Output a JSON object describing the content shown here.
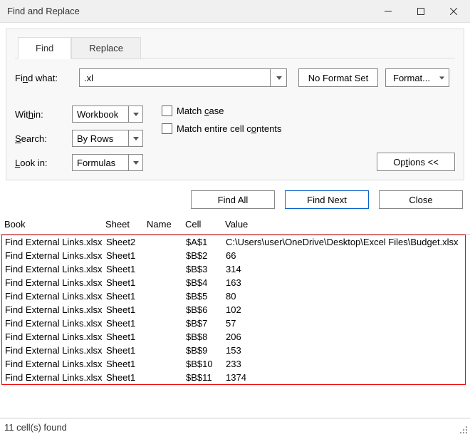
{
  "window": {
    "title": "Find and Replace"
  },
  "tabs": {
    "find": "Find",
    "replace": "Replace"
  },
  "findwhat_label": "Find what:",
  "findwhat_value": ".xl",
  "noformat": "No Format Set",
  "format": "Format...",
  "opts": {
    "within_label": "Within:",
    "within_value": "Workbook",
    "search_label": "Search:",
    "search_value": "By Rows",
    "lookin_label": "Look in:",
    "lookin_value": "Formulas",
    "matchcase": "Match case",
    "matchentire": "Match entire cell contents",
    "options_btn": "Options <<"
  },
  "actions": {
    "findall": "Find All",
    "findnext": "Find Next",
    "close": "Close"
  },
  "columns": {
    "book": "Book",
    "sheet": "Sheet",
    "name": "Name",
    "cell": "Cell",
    "value": "Value"
  },
  "rows": [
    {
      "book": "Find External Links.xlsx",
      "sheet": "Sheet2",
      "name": "",
      "cell": "$A$1",
      "value": "C:\\Users\\user\\OneDrive\\Desktop\\Excel Files\\Budget.xlsx"
    },
    {
      "book": "Find External Links.xlsx",
      "sheet": "Sheet1",
      "name": "",
      "cell": "$B$2",
      "value": "66"
    },
    {
      "book": "Find External Links.xlsx",
      "sheet": "Sheet1",
      "name": "",
      "cell": "$B$3",
      "value": "314"
    },
    {
      "book": "Find External Links.xlsx",
      "sheet": "Sheet1",
      "name": "",
      "cell": "$B$4",
      "value": "163"
    },
    {
      "book": "Find External Links.xlsx",
      "sheet": "Sheet1",
      "name": "",
      "cell": "$B$5",
      "value": "80"
    },
    {
      "book": "Find External Links.xlsx",
      "sheet": "Sheet1",
      "name": "",
      "cell": "$B$6",
      "value": "102"
    },
    {
      "book": "Find External Links.xlsx",
      "sheet": "Sheet1",
      "name": "",
      "cell": "$B$7",
      "value": "57"
    },
    {
      "book": "Find External Links.xlsx",
      "sheet": "Sheet1",
      "name": "",
      "cell": "$B$8",
      "value": "206"
    },
    {
      "book": "Find External Links.xlsx",
      "sheet": "Sheet1",
      "name": "",
      "cell": "$B$9",
      "value": "153"
    },
    {
      "book": "Find External Links.xlsx",
      "sheet": "Sheet1",
      "name": "",
      "cell": "$B$10",
      "value": "233"
    },
    {
      "book": "Find External Links.xlsx",
      "sheet": "Sheet1",
      "name": "",
      "cell": "$B$11",
      "value": "1374"
    }
  ],
  "status": "11 cell(s) found"
}
